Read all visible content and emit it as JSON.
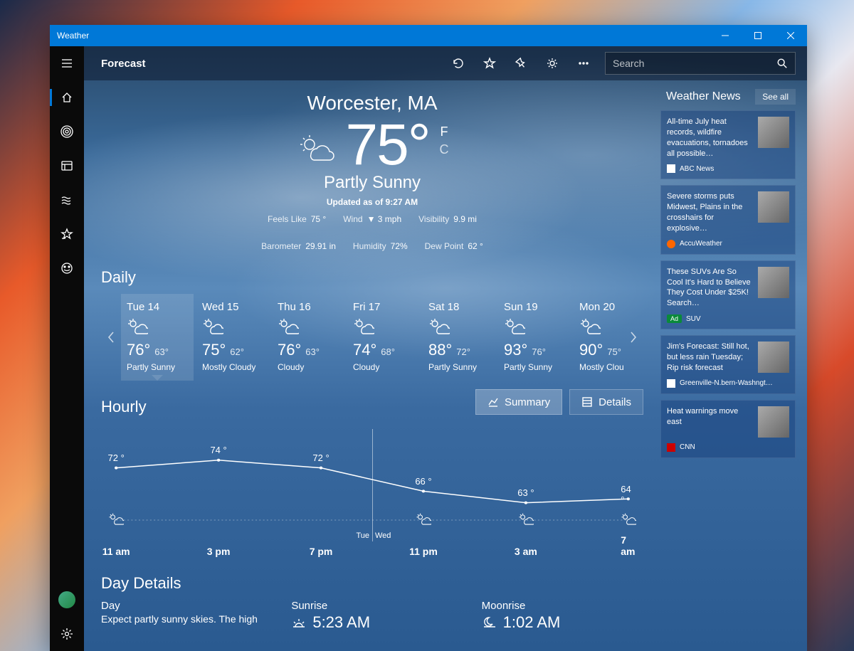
{
  "window": {
    "title": "Weather"
  },
  "page": {
    "title": "Forecast"
  },
  "search": {
    "placeholder": "Search"
  },
  "hero": {
    "location": "Worcester, MA",
    "temp": "75°",
    "unit_f": "F",
    "unit_c": "C",
    "condition": "Partly Sunny",
    "updated": "Updated as of 9:27 AM"
  },
  "metrics": [
    {
      "label": "Feels Like",
      "value": "75 °"
    },
    {
      "label": "Wind",
      "value": "▼ 3 mph"
    },
    {
      "label": "Visibility",
      "value": "9.9 mi"
    },
    {
      "label": "Barometer",
      "value": "29.91 in"
    },
    {
      "label": "Humidity",
      "value": "72%"
    },
    {
      "label": "Dew Point",
      "value": "62 °"
    }
  ],
  "sections": {
    "daily": "Daily",
    "hourly": "Hourly",
    "details": "Day Details"
  },
  "daily": [
    {
      "date": "Tue 14",
      "hi": "76°",
      "lo": "63°",
      "cond": "Partly Sunny",
      "selected": true
    },
    {
      "date": "Wed 15",
      "hi": "75°",
      "lo": "62°",
      "cond": "Mostly Cloudy"
    },
    {
      "date": "Thu 16",
      "hi": "76°",
      "lo": "63°",
      "cond": "Cloudy"
    },
    {
      "date": "Fri 17",
      "hi": "74°",
      "lo": "68°",
      "cond": "Cloudy"
    },
    {
      "date": "Sat 18",
      "hi": "88°",
      "lo": "72°",
      "cond": "Partly Sunny"
    },
    {
      "date": "Sun 19",
      "hi": "93°",
      "lo": "76°",
      "cond": "Partly Sunny"
    },
    {
      "date": "Mon 20",
      "hi": "90°",
      "lo": "75°",
      "cond": "Mostly Cloudy"
    }
  ],
  "hourly_toggle": {
    "summary": "Summary",
    "details": "Details"
  },
  "hourly_daylabels": {
    "tue": "Tue",
    "wed": "Wed"
  },
  "chart_data": {
    "type": "line",
    "title": "Hourly",
    "xlabel": "",
    "ylabel": "",
    "x": [
      "11 am",
      "3 pm",
      "7 pm",
      "11 pm",
      "3 am",
      "7 am"
    ],
    "values": [
      72,
      74,
      72,
      66,
      63,
      64
    ],
    "value_labels": [
      "72 °",
      "74 °",
      "72 °",
      "66 °",
      "63 °",
      "64 °"
    ],
    "ylim": [
      60,
      78
    ],
    "day_boundary_index": 3
  },
  "details": {
    "day_label": "Day",
    "day_text": "Expect partly sunny skies. The high",
    "sunrise_label": "Sunrise",
    "sunrise_value": "5:23 AM",
    "moonrise_label": "Moonrise",
    "moonrise_value": "1:02 AM"
  },
  "news_title": "Weather News",
  "see_all": "See all",
  "news": [
    {
      "headline": "All-time July heat records, wildfire evacuations, tornadoes all possible…",
      "source": "ABC News",
      "logo": "abc"
    },
    {
      "headline": "Severe storms puts Midwest, Plains in the crosshairs for explosive…",
      "source": "AccuWeather",
      "logo": "accu"
    },
    {
      "headline": "These SUVs Are So Cool It's Hard to Believe They Cost Under $25K! Search…",
      "source": "SUV",
      "logo": "ad",
      "ad": true
    },
    {
      "headline": "Jim's Forecast: Still hot, but less rain Tuesday; Rip risk forecast",
      "source": "Greenville-N.bern-Washngt…",
      "logo": "local"
    },
    {
      "headline": "Heat warnings move east",
      "source": "CNN",
      "logo": "cnn"
    }
  ]
}
